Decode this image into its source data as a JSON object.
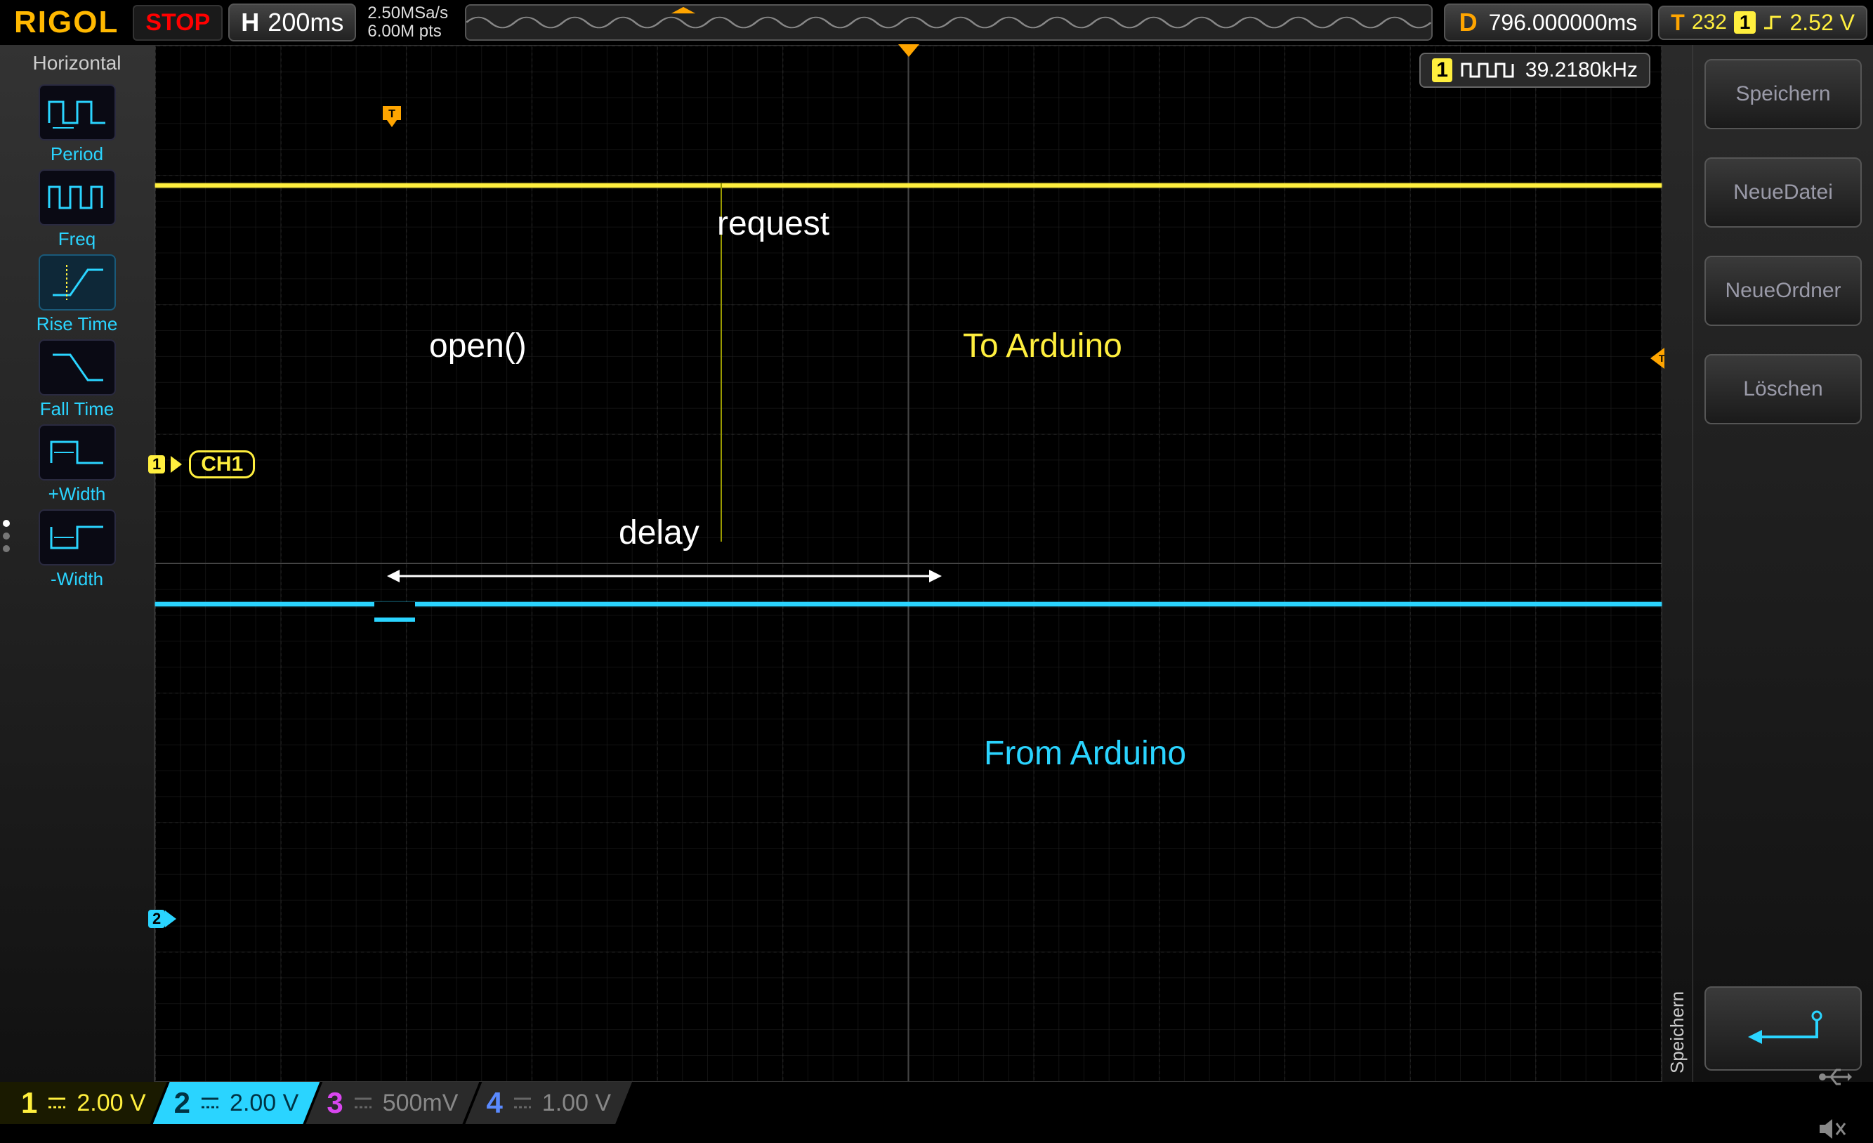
{
  "brand": "RIGOL",
  "run_state": "STOP",
  "timebase": {
    "label": "H",
    "value": "200ms"
  },
  "acquisition": {
    "sample_rate": "2.50MSa/s",
    "mem_depth": "6.00M pts"
  },
  "delay": {
    "label": "D",
    "value": "796.000000ms"
  },
  "trigger": {
    "label": "T",
    "num": "232",
    "channel": "1",
    "level": "2.52 V"
  },
  "left_panel": {
    "title": "Horizontal",
    "items": [
      {
        "label": "Period"
      },
      {
        "label": "Freq"
      },
      {
        "label": "Rise Time"
      },
      {
        "label": "Fall Time"
      },
      {
        "label": "+Width"
      },
      {
        "label": "-Width"
      }
    ]
  },
  "right_panel": {
    "title": "Speichern",
    "buttons": [
      "Speichern",
      "NeueDatei",
      "NeueOrdner",
      "Löschen"
    ]
  },
  "freq_meas": {
    "channel": "1",
    "value": "39.2180kHz"
  },
  "ch1_label": "CH1",
  "annotations": {
    "request": "request",
    "open": "open()",
    "to": "To Arduino",
    "delay": "delay",
    "from": "From Arduino"
  },
  "channels": [
    {
      "n": "1",
      "scale": "2.00 V",
      "active": true,
      "color": "yellow"
    },
    {
      "n": "2",
      "scale": "2.00 V",
      "active": true,
      "color": "cyan"
    },
    {
      "n": "3",
      "scale": "500mV",
      "active": false,
      "color": "magenta"
    },
    {
      "n": "4",
      "scale": "1.00 V",
      "active": false,
      "color": "blue"
    }
  ],
  "colors": {
    "yellow": "#ffef3e",
    "cyan": "#2ad4ff",
    "orange": "#ffa500"
  }
}
